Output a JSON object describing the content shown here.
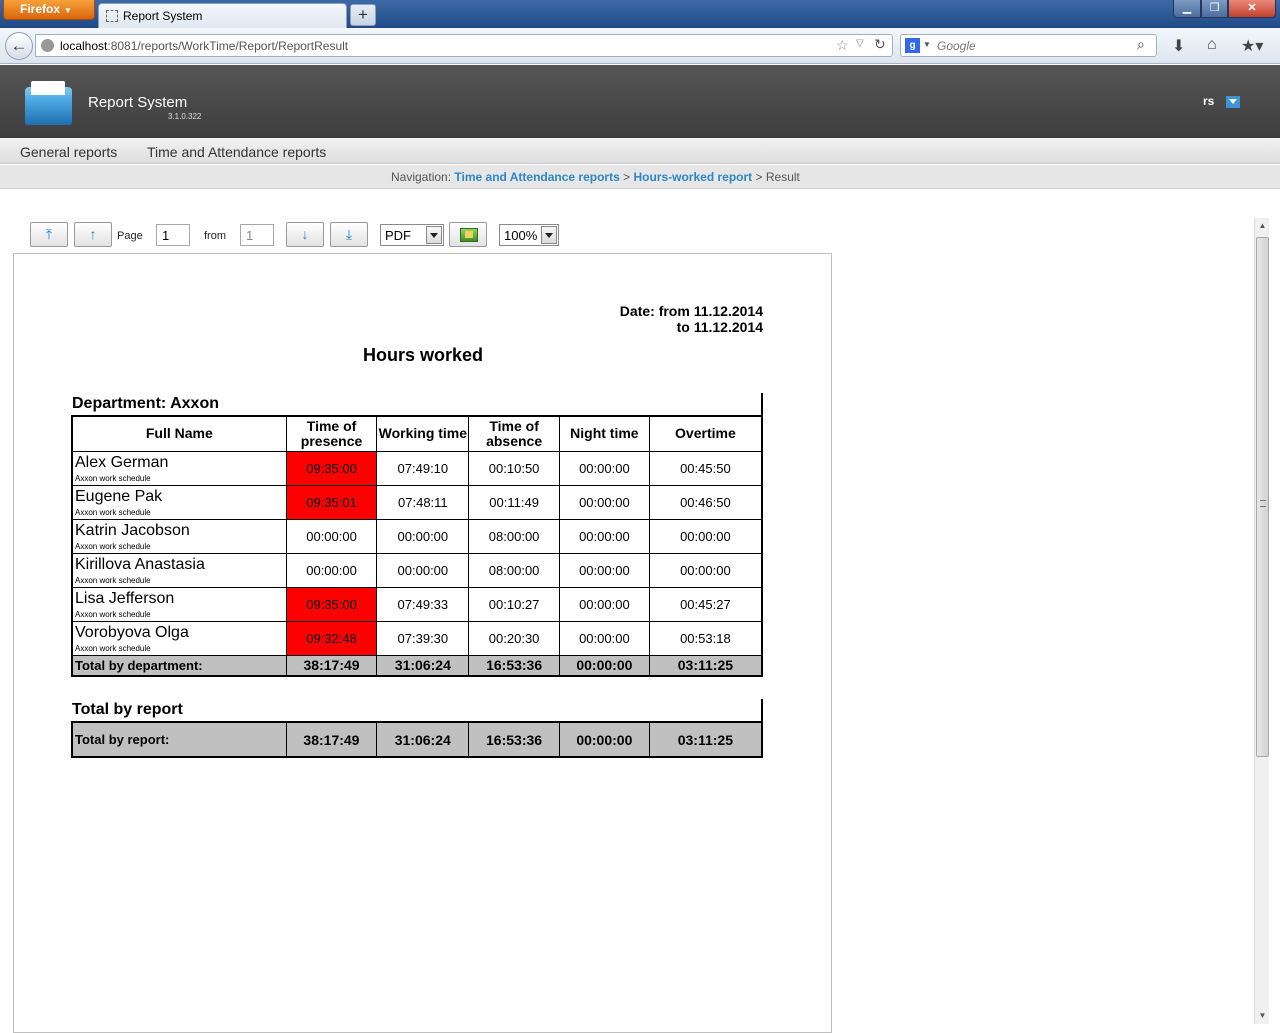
{
  "browser": {
    "menu_label": "Firefox",
    "tab_title": "Report System",
    "new_tab": "+",
    "url_host": "localhost",
    "url_path": ":8081/reports/WorkTime/Report/ReportResult",
    "search_placeholder": "Google",
    "search_engine": "g",
    "window_buttons": {
      "minimize": "▁",
      "maximize": "❐",
      "close": "✕"
    },
    "icons": [
      "back-arrow-icon",
      "site-identity-icon",
      "bookmark-star-icon",
      "reload-icon",
      "search-icon",
      "download-icon",
      "home-icon",
      "bookmarks-icon"
    ]
  },
  "app": {
    "title": "Report System",
    "version": "3.1.0.322",
    "user": "rs"
  },
  "menu": {
    "general": "General reports",
    "time": "Time and Attendance reports"
  },
  "breadcrumb": {
    "prefix": "Navigation:",
    "link1": "Time and Attendance reports",
    "sep": ">",
    "link2": "Hours-worked report",
    "current": "Result"
  },
  "toolbar": {
    "page_label": "Page",
    "page_value": "1",
    "from_label": "from",
    "total_pages": "1",
    "format": "PDF",
    "zoom": "100%",
    "first_icon": "⤒",
    "prev_icon": "↑",
    "next_icon": "↓",
    "last_icon": "⤓"
  },
  "report": {
    "date_line1": "Date: from 11.12.2014",
    "date_line2": "to 11.12.2014",
    "title": "Hours worked",
    "department_header": "Department: Axxon",
    "columns": [
      "Full Name",
      "Time of presence",
      "Working time",
      "Time of absence",
      "Night time",
      "Overtime"
    ],
    "highlight_color": "#fe0000",
    "rows": [
      {
        "name": "Alex German",
        "schedule": "Axxon work schedule",
        "presence": "09:35:00",
        "working": "07:49:10",
        "absence": "00:10:50",
        "night": "00:00:00",
        "overtime": "00:45:50",
        "highlight": true
      },
      {
        "name": "Eugene Pak",
        "schedule": "Axxon work schedule",
        "presence": "09:35:01",
        "working": "07:48:11",
        "absence": "00:11:49",
        "night": "00:00:00",
        "overtime": "00:46:50",
        "highlight": true
      },
      {
        "name": "Katrin Jacobson",
        "schedule": "Axxon work schedule",
        "presence": "00:00:00",
        "working": "00:00:00",
        "absence": "08:00:00",
        "night": "00:00:00",
        "overtime": "00:00:00",
        "highlight": false
      },
      {
        "name": "Kirillova Anastasia",
        "schedule": "Axxon work schedule",
        "presence": "00:00:00",
        "working": "00:00:00",
        "absence": "08:00:00",
        "night": "00:00:00",
        "overtime": "00:00:00",
        "highlight": false
      },
      {
        "name": "Lisa Jefferson",
        "schedule": "Axxon work schedule",
        "presence": "09:35:00",
        "working": "07:49:33",
        "absence": "00:10:27",
        "night": "00:00:00",
        "overtime": "00:45:27",
        "highlight": true
      },
      {
        "name": "Vorobyova Olga",
        "schedule": "Axxon work schedule",
        "presence": "09:32:48",
        "working": "07:39:30",
        "absence": "00:20:30",
        "night": "00:00:00",
        "overtime": "00:53:18",
        "highlight": true
      }
    ],
    "dept_total": {
      "label": "Total by department:",
      "presence": "38:17:49",
      "working": "31:06:24",
      "absence": "16:53:36",
      "night": "00:00:00",
      "overtime": "03:11:25"
    },
    "report_total_header": "Total by report",
    "report_total": {
      "label": "Total by report:",
      "presence": "38:17:49",
      "working": "31:06:24",
      "absence": "16:53:36",
      "night": "00:00:00",
      "overtime": "03:11:25"
    }
  }
}
